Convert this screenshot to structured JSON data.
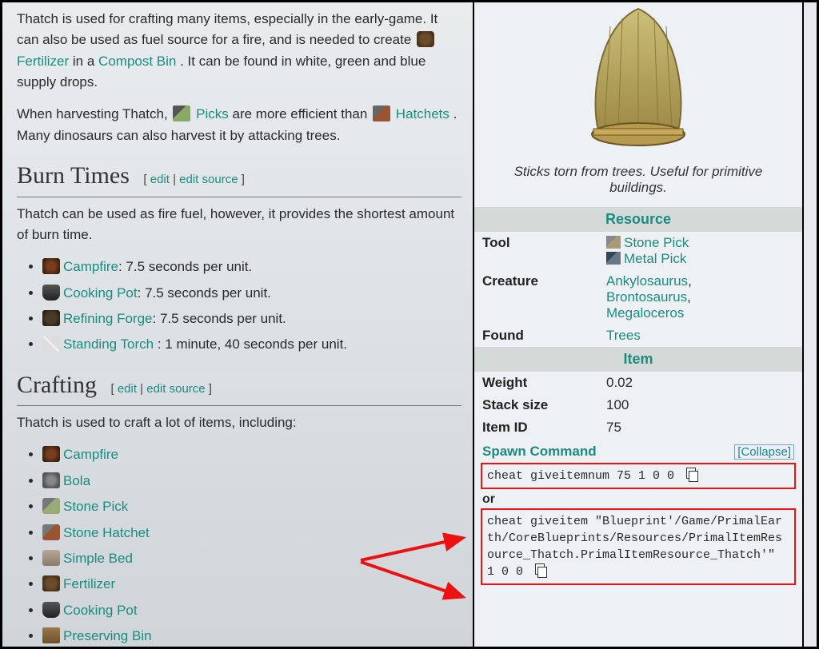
{
  "intro": {
    "p1_a": "Thatch is used for crafting many items, especially in the early-game. It can also be used as fuel source for a fire, and is needed to create ",
    "fertilizer": "Fertilizer",
    "p1_b": " in a ",
    "compost_bin": "Compost Bin",
    "p1_c": ". It can be found in white, green and blue supply drops.",
    "p2_a": "When harvesting Thatch, ",
    "picks": "Picks",
    "p2_b": " are more efficient than ",
    "hatchets": "Hatchets",
    "p2_c": ". Many dinosaurs can also harvest it by attacking trees."
  },
  "sections": {
    "burn_times": "Burn Times",
    "crafting": "Crafting",
    "edit": "edit",
    "edit_source": "edit source"
  },
  "burn": {
    "intro": "Thatch can be used as fire fuel, however, it provides the shortest amount of burn time.",
    "items": [
      {
        "name": "Campfire",
        "rest": ": 7.5 seconds per unit.",
        "icon": "ic-campfire"
      },
      {
        "name": "Cooking Pot",
        "rest": ": 7.5 seconds per unit.",
        "icon": "ic-cookpot"
      },
      {
        "name": "Refining Forge",
        "rest": ": 7.5 seconds per unit.",
        "icon": "ic-forge"
      },
      {
        "name": "Standing Torch",
        "rest": " : 1 minute, 40 seconds per unit.",
        "icon": "ic-torch"
      }
    ]
  },
  "crafting": {
    "intro": "Thatch is used to craft a lot of items, including:",
    "items": [
      {
        "name": "Campfire",
        "icon": "ic-campfire"
      },
      {
        "name": "Bola",
        "icon": "ic-bola"
      },
      {
        "name": "Stone Pick",
        "icon": "ic-spick"
      },
      {
        "name": "Stone Hatchet",
        "icon": "ic-shatchet"
      },
      {
        "name": "Simple Bed",
        "icon": "ic-bed"
      },
      {
        "name": "Fertilizer",
        "icon": "ic-fert"
      },
      {
        "name": "Cooking Pot",
        "icon": "ic-cookpot"
      },
      {
        "name": "Preserving Bin",
        "icon": "ic-pres"
      }
    ]
  },
  "infobox": {
    "caption": "Sticks torn from trees. Useful for primitive buildings.",
    "resource_header": "Resource",
    "tool_label": "Tool",
    "tools": [
      "Stone Pick",
      "Metal Pick"
    ],
    "creature_label": "Creature",
    "creatures": [
      "Ankylosaurus",
      "Brontosaurus",
      "Megaloceros"
    ],
    "found_label": "Found",
    "found": "Trees",
    "item_header": "Item",
    "weight_label": "Weight",
    "weight": "0.02",
    "stack_label": "Stack size",
    "stack": "100",
    "id_label": "Item ID",
    "id": "75",
    "spawn_label": "Spawn Command",
    "collapse": "Collapse",
    "cmd1": "cheat giveitemnum 75 1 0 0",
    "or": "or",
    "cmd2": "cheat giveitem \"Blueprint'/Game/PrimalEarth/CoreBlueprints/Resources/PrimalItemResource_Thatch.PrimalItemResource_Thatch'\" 1 0 0"
  }
}
